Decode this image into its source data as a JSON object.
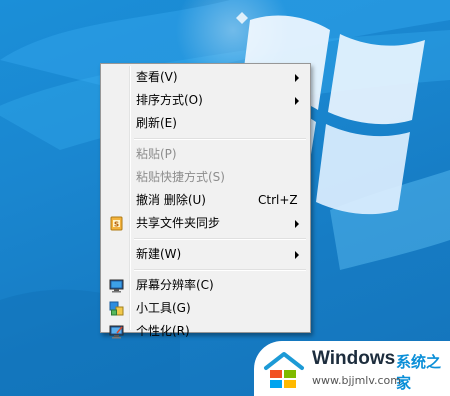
{
  "menu": {
    "items": [
      {
        "label": "查看(V)",
        "submenu": true
      },
      {
        "label": "排序方式(O)",
        "submenu": true
      },
      {
        "label": "刷新(E)"
      },
      {
        "label": "粘贴(P)",
        "disabled": true
      },
      {
        "label": "粘贴快捷方式(S)",
        "disabled": true
      },
      {
        "label": "撤消 删除(U)",
        "shortcut": "Ctrl+Z"
      },
      {
        "label": "共享文件夹同步",
        "submenu": true,
        "icon": "sync-icon"
      },
      {
        "label": "新建(W)",
        "submenu": true
      },
      {
        "label": "屏幕分辨率(C)",
        "icon": "display-icon"
      },
      {
        "label": "小工具(G)",
        "icon": "gadgets-icon"
      },
      {
        "label": "个性化(R)",
        "icon": "personalize-icon"
      }
    ]
  },
  "badge": {
    "title": "Windows",
    "subtitle": "系统之家",
    "url": "www.bjjmlv.com"
  },
  "colors": {
    "desktop": "#1a86cf",
    "menu_bg": "#f1f1f1",
    "disabled_text": "#8d8d8d",
    "accent": "#0a8fd8"
  }
}
